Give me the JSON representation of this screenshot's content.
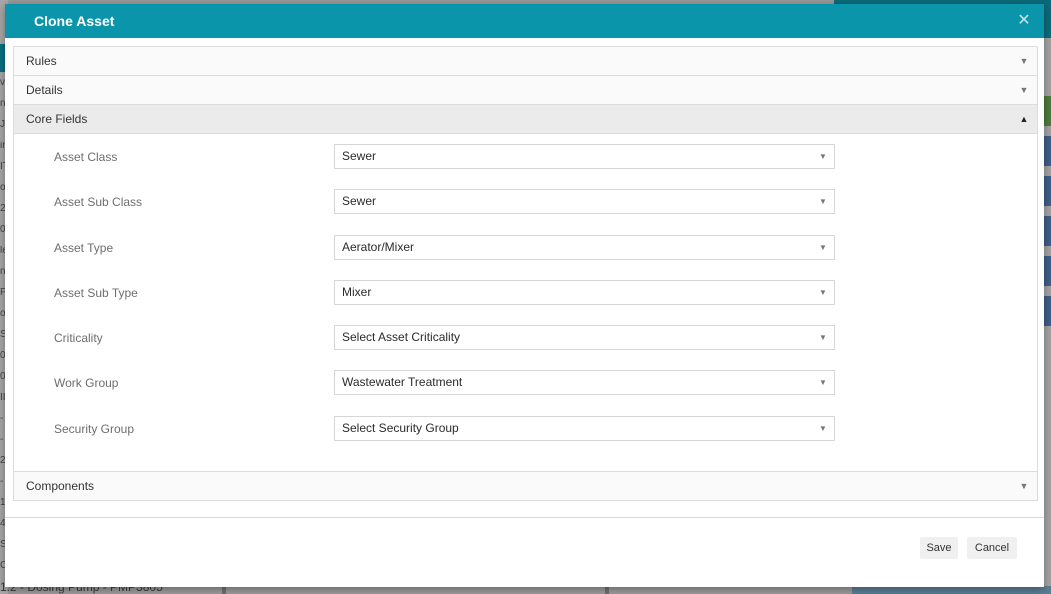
{
  "background": {
    "left_fragments": [
      "v",
      "nt",
      "Ju",
      "in",
      "IT",
      "ol",
      "21",
      "0(",
      "le",
      "nu",
      "Pt",
      "oc",
      "S7",
      "08",
      "0(",
      "II",
      "-",
      "-",
      "21",
      "-",
      "1(",
      "41",
      "S1",
      "C",
      "S",
      "8",
      "-",
      "..."
    ],
    "bottom_text": "1.2 - Dosing Pump - PMP3805"
  },
  "modal": {
    "title": "Clone Asset",
    "close_icon": "close-icon",
    "sections": {
      "rules": "Rules",
      "details": "Details",
      "core_fields": "Core Fields",
      "components": "Components"
    },
    "fields": [
      {
        "label": "Asset Class",
        "value": "Sewer"
      },
      {
        "label": "Asset Sub Class",
        "value": "Sewer"
      },
      {
        "label": "Asset Type",
        "value": "Aerator/Mixer"
      },
      {
        "label": "Asset Sub Type",
        "value": "Mixer"
      },
      {
        "label": "Criticality",
        "value": "Select Asset Criticality"
      },
      {
        "label": "Work Group",
        "value": "Wastewater Treatment"
      },
      {
        "label": "Security Group",
        "value": "Select Security Group"
      }
    ],
    "buttons": {
      "save": "Save",
      "cancel": "Cancel"
    }
  },
  "colors": {
    "header": "#0b95ab",
    "header_text": "#ffffff",
    "overlay": "#9a9a9a"
  }
}
